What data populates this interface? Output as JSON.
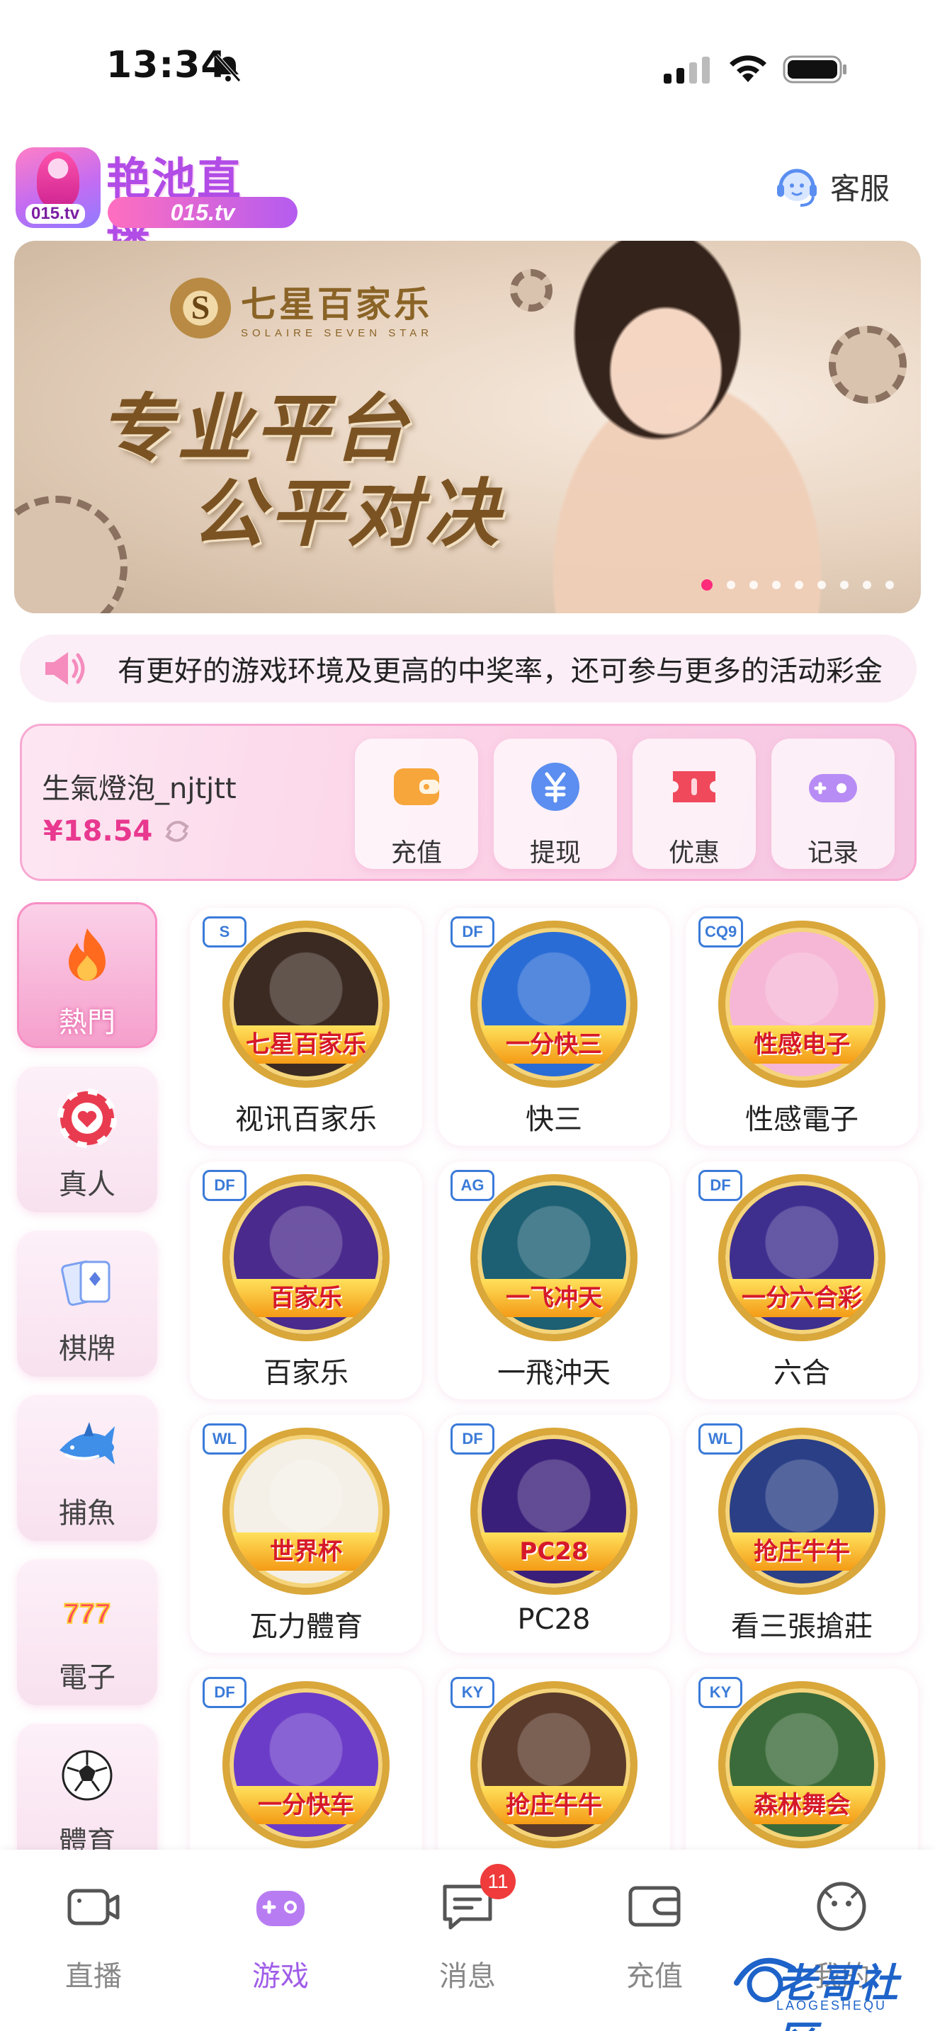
{
  "status_bar": {
    "time": "13:34"
  },
  "header": {
    "app_name": "艳池直播",
    "app_url": "015.tv",
    "logo_badge_text": "015.tv",
    "service_label": "客服"
  },
  "banner": {
    "brand_cn": "七星百家乐",
    "brand_en": "SOLAIRE SEVEN STAR",
    "slogan_line1": "专业平台",
    "slogan_line2": "公平对决",
    "dots_total": 9,
    "active_index": 0
  },
  "notice": {
    "text": "有更好的游戏环境及更高的中奖率，还可参与更多的活动彩金"
  },
  "user": {
    "username": "生氣燈泡_njtjtt",
    "balance": "¥18.54",
    "actions": [
      {
        "label": "充值",
        "icon": "wallet-icon",
        "color": "#f7a63c"
      },
      {
        "label": "提现",
        "icon": "yen-coin-icon",
        "color": "#5b8ef0"
      },
      {
        "label": "优惠",
        "icon": "ticket-icon",
        "color": "#f0495c"
      },
      {
        "label": "记录",
        "icon": "gamepad-icon",
        "color": "#b88cf5"
      }
    ]
  },
  "categories": [
    {
      "label": "熱門",
      "icon": "flame-icon",
      "active": true
    },
    {
      "label": "真人",
      "icon": "poker-chip-icon",
      "active": false
    },
    {
      "label": "棋牌",
      "icon": "playing-cards-icon",
      "active": false
    },
    {
      "label": "捕魚",
      "icon": "shark-icon",
      "active": false
    },
    {
      "label": "電子",
      "icon": "slot-777-icon",
      "active": false
    },
    {
      "label": "體育",
      "icon": "soccer-ball-icon",
      "active": false
    }
  ],
  "games": [
    {
      "label": "视讯百家乐",
      "ribbon": "七星百家乐",
      "badge": "S",
      "theme": "#3b2a22"
    },
    {
      "label": "快三",
      "ribbon": "一分快三",
      "badge": "DF",
      "theme": "#2a6cd6"
    },
    {
      "label": "性感電子",
      "ribbon": "性感电子",
      "badge": "CQ9",
      "theme": "#f6b7d6"
    },
    {
      "label": "百家乐",
      "ribbon": "百家乐",
      "badge": "DF",
      "theme": "#4a2a8c"
    },
    {
      "label": "一飛沖天",
      "ribbon": "一飞冲天",
      "badge": "AG",
      "theme": "#1d5f73"
    },
    {
      "label": "六合",
      "ribbon": "一分六合彩",
      "badge": "DF",
      "theme": "#3e2f8f"
    },
    {
      "label": "瓦力體育",
      "ribbon": "世界杯",
      "badge": "WL",
      "theme": "#f4f0e8"
    },
    {
      "label": "PC28",
      "ribbon": "PC28",
      "badge": "DF",
      "theme": "#3a1f7a"
    },
    {
      "label": "看三張搶莊",
      "ribbon": "抢庄牛牛",
      "badge": "WL",
      "theme": "#2a3f86"
    },
    {
      "label": "",
      "ribbon": "一分快车",
      "badge": "DF",
      "theme": "#6b3cc8"
    },
    {
      "label": "",
      "ribbon": "抢庄牛牛",
      "badge": "KY",
      "theme": "#5a3a2a"
    },
    {
      "label": "",
      "ribbon": "森林舞会",
      "badge": "KY",
      "theme": "#3b6b3a"
    }
  ],
  "tabbar": {
    "items": [
      {
        "label": "直播",
        "icon": "video-camera-icon",
        "active": false
      },
      {
        "label": "游戏",
        "icon": "game-controller-icon",
        "active": true
      },
      {
        "label": "消息",
        "icon": "message-icon",
        "active": false,
        "badge": "11"
      },
      {
        "label": "充值",
        "icon": "wallet-icon",
        "active": false
      },
      {
        "label": "我的",
        "icon": "profile-face-icon",
        "active": false
      }
    ]
  },
  "watermark": {
    "text": "老哥社区",
    "sub": "LAOGESHEQU"
  },
  "colors": {
    "accent": "#f56fb4",
    "active_tab": "#a05ee8",
    "balance": "#e8388f"
  }
}
